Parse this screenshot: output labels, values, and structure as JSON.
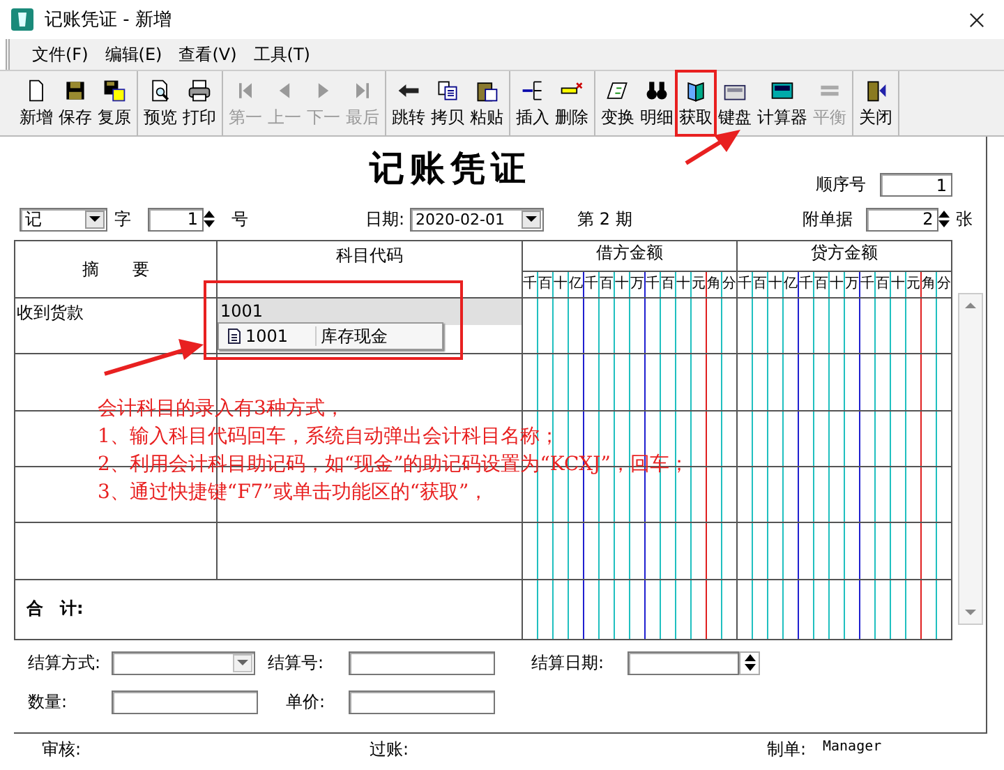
{
  "window": {
    "title": "记账凭证 - 新增"
  },
  "menu": [
    "文件(F)",
    "编辑(E)",
    "查看(V)",
    "工具(T)"
  ],
  "toolbar": [
    [
      {
        "label": "新增",
        "disabled": false,
        "marked": false
      },
      {
        "label": "保存",
        "disabled": false,
        "marked": false
      },
      {
        "label": "复原",
        "disabled": false,
        "marked": false
      }
    ],
    [
      {
        "label": "预览",
        "disabled": false,
        "marked": false
      },
      {
        "label": "打印",
        "disabled": false,
        "marked": false
      }
    ],
    [
      {
        "label": "第一",
        "disabled": true,
        "marked": false
      },
      {
        "label": "上一",
        "disabled": true,
        "marked": false
      },
      {
        "label": "下一",
        "disabled": true,
        "marked": false
      },
      {
        "label": "最后",
        "disabled": true,
        "marked": false
      }
    ],
    [
      {
        "label": "跳转",
        "disabled": false,
        "marked": false
      },
      {
        "label": "拷贝",
        "disabled": false,
        "marked": false
      },
      {
        "label": "粘贴",
        "disabled": false,
        "marked": false
      }
    ],
    [
      {
        "label": "插入",
        "disabled": false,
        "marked": false
      },
      {
        "label": "删除",
        "disabled": false,
        "marked": false
      }
    ],
    [
      {
        "label": "变换",
        "disabled": false,
        "marked": false
      },
      {
        "label": "明细",
        "disabled": false,
        "marked": false
      },
      {
        "label": "获取",
        "disabled": false,
        "marked": true
      },
      {
        "label": "键盘",
        "disabled": false,
        "marked": false
      },
      {
        "label": "计算器",
        "disabled": false,
        "marked": false
      },
      {
        "label": "平衡",
        "disabled": true,
        "marked": false
      }
    ],
    [
      {
        "label": "关闭",
        "disabled": false,
        "marked": false
      }
    ]
  ],
  "voucher": {
    "title": "记账凭证",
    "sequence_label": "顺序号",
    "sequence": "1",
    "type": "记",
    "type_suffix": "字",
    "number": "1",
    "number_suffix": "号",
    "date_label": "日期:",
    "date": "2020-02-01",
    "period": "第 2 期",
    "attachments_label": "附单据",
    "attachments": "2",
    "attachments_suffix": "张"
  },
  "table": {
    "summary_header": "摘　　要",
    "code_header": "科目代码",
    "amount_columns": [
      {
        "title": "借方金额",
        "digits": [
          "千",
          "百",
          "十",
          "亿",
          "千",
          "百",
          "十",
          "万",
          "千",
          "百",
          "十",
          "元",
          "角",
          "分"
        ]
      },
      {
        "title": "贷方金额",
        "digits": [
          "千",
          "百",
          "十",
          "亿",
          "千",
          "百",
          "十",
          "万",
          "千",
          "百",
          "十",
          "元",
          "角",
          "分"
        ]
      }
    ],
    "rows": [
      {
        "summary": "收到货款",
        "code": "1001",
        "selected": true,
        "marked": true
      },
      {
        "selected": false,
        "marked": false
      },
      {
        "selected": false,
        "marked": false
      },
      {
        "selected": false,
        "marked": false
      },
      {
        "selected": false,
        "marked": false
      }
    ],
    "suggestion": {
      "code": "1001",
      "name": "库存现金"
    },
    "total_label": "合　计:"
  },
  "annotation": [
    "会计科目的录入有3种方式，",
    "1、输入科目代码回车，系统自动弹出会计科目名称；",
    "2、利用会计科目助记码，如“现金”的助记码设置为“KCXJ”，回车；",
    "3、通过快捷键“F7”或单击功能区的“获取”，"
  ],
  "settlement": {
    "method_label": "结算方式:",
    "number_label": "结算号:",
    "date_label": "结算日期:",
    "quantity_label": "数量:",
    "price_label": "单价:"
  },
  "footer": {
    "reviewer_label": "审核:",
    "posting_label": "过账:",
    "maker_label": "制单:",
    "maker": "Manager"
  }
}
